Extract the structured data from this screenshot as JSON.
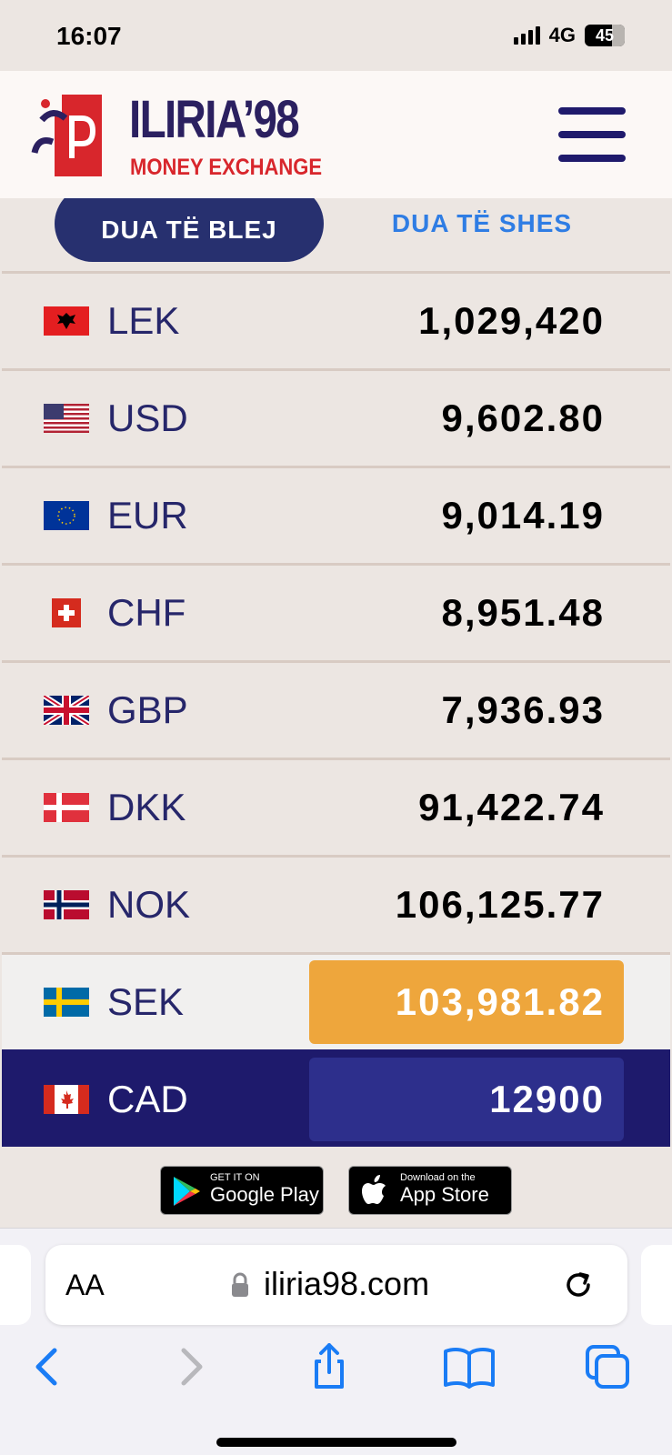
{
  "status_bar": {
    "time": "16:07",
    "network": "4G",
    "battery": "45"
  },
  "header": {
    "brand_name": "ILIRIA’98",
    "brand_subtitle": "MONEY EXCHANGE",
    "brand_color": "#2b2060",
    "accent_color": "#d8262c",
    "menu_icon": "hamburger-menu-icon"
  },
  "tabs": {
    "buy_label": "DUA TË BLEJ",
    "sell_label": "DUA TË SHES"
  },
  "rates": [
    {
      "code": "LEK",
      "value": "1,029,420",
      "flag": "albania-flag-icon"
    },
    {
      "code": "USD",
      "value": "9,602.80",
      "flag": "usa-flag-icon"
    },
    {
      "code": "EUR",
      "value": "9,014.19",
      "flag": "eu-flag-icon"
    },
    {
      "code": "CHF",
      "value": "8,951.48",
      "flag": "switzerland-flag-icon"
    },
    {
      "code": "GBP",
      "value": "7,936.93",
      "flag": "uk-flag-icon"
    },
    {
      "code": "DKK",
      "value": "91,422.74",
      "flag": "denmark-flag-icon"
    },
    {
      "code": "NOK",
      "value": "106,125.77",
      "flag": "norway-flag-icon"
    },
    {
      "code": "SEK",
      "value": "103,981.82",
      "flag": "sweden-flag-icon"
    },
    {
      "code": "CAD",
      "value": "12900",
      "flag": "canada-flag-icon"
    }
  ],
  "stores": {
    "google_play_small": "GET IT ON",
    "google_play_big": "Google Play",
    "app_store_small": "Download on the",
    "app_store_big": "App Store"
  },
  "browser": {
    "text_size_label": "AA",
    "url": "iliria98.com"
  }
}
